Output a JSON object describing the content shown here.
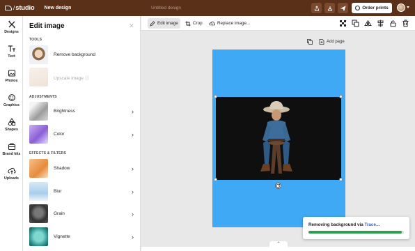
{
  "topbar": {
    "logo_text": "studio",
    "design_name": "New design",
    "document_title": "Untitled design",
    "order_label": "Order prints",
    "icons": [
      "share-icon",
      "download-icon",
      "send-icon"
    ],
    "bg_color": "#5a3019"
  },
  "nav": {
    "items": [
      {
        "label": "Designs",
        "icon": "designs-icon"
      },
      {
        "label": "Text",
        "icon": "text-icon"
      },
      {
        "label": "Photos",
        "icon": "photos-icon"
      },
      {
        "label": "Graphics",
        "icon": "graphics-icon"
      },
      {
        "label": "Shapes",
        "icon": "shapes-icon"
      },
      {
        "label": "Brand kits",
        "icon": "brand-kits-icon"
      },
      {
        "label": "Uploads",
        "icon": "uploads-icon"
      }
    ]
  },
  "panel": {
    "title": "Edit image",
    "tools_heading": "TOOLS",
    "remove_bg_label": "Remove background",
    "upscale_label": "Upscale image ⓘ",
    "adjustments_heading": "ADJUSTMENTS",
    "brightness_label": "Brightness",
    "color_label": "Color",
    "effects_heading": "EFFECTS & FILTERS",
    "shadow_label": "Shadow",
    "blur_label": "Blur",
    "grain_label": "Grain",
    "vignette_label": "Vignette"
  },
  "toolbar": {
    "edit_image_label": "Edit image",
    "crop_label": "Crop",
    "replace_label": "Replace image..."
  },
  "canvas": {
    "add_page_label": "Add page",
    "artboard_color": "#3fa9f5"
  },
  "toast": {
    "text": "Removing background via ",
    "link": "Trace...",
    "progress_fraction": 0.98,
    "progress_color": "#2e9e4f"
  }
}
